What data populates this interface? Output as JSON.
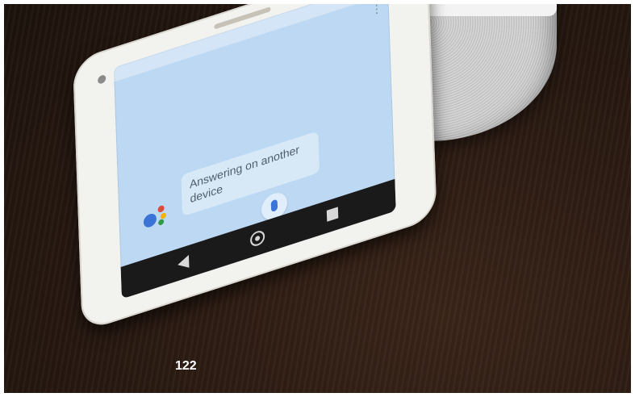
{
  "assistant_bubble": {
    "line1": "Answering on another",
    "line2": "device"
  },
  "caption": "122"
}
